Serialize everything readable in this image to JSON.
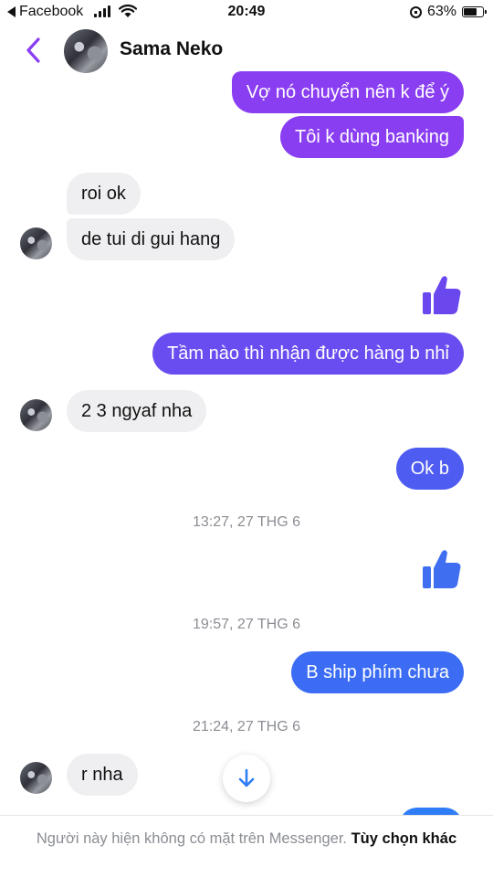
{
  "status_bar": {
    "back_app": "Facebook",
    "time": "20:49",
    "battery": "63%",
    "battery_level": 0.63
  },
  "header": {
    "contact_name": "Sama Neko"
  },
  "messages": [
    {
      "text": "Vợ nó chuyển nên k để ý",
      "dir": "out",
      "color": "#8a3ef2"
    },
    {
      "text": "Tôi k dùng banking",
      "dir": "out",
      "color": "#8a3ef2"
    },
    {
      "text": "roi ok",
      "dir": "in"
    },
    {
      "text": "de tui di gui hang",
      "dir": "in"
    },
    {
      "text": "Tầm nào thì nhận được hàng b nhỉ",
      "dir": "out",
      "color": "#6a4df0"
    },
    {
      "text": "2 3 ngyaf nha",
      "dir": "in"
    },
    {
      "text": "Ok b",
      "dir": "out",
      "color": "#4f5cf2"
    },
    {
      "text": "B ship phím chưa",
      "dir": "out",
      "color": "#3b6cf3"
    },
    {
      "text": "r nha",
      "dir": "in"
    }
  ],
  "timestamps": [
    "13:27, 27 THG 6",
    "19:57, 27 THG 6",
    "21:24, 27 THG 6"
  ],
  "like_colors": [
    "#6a48ee",
    "#3f6ef1"
  ],
  "footer": {
    "notice": "Người này hiện không có mặt trên Messenger.",
    "action": "Tùy chọn khác"
  },
  "colors": {
    "accent": "#8a3ef2",
    "incoming_bubble": "#efeff1",
    "timestamp": "#8a8d93"
  }
}
